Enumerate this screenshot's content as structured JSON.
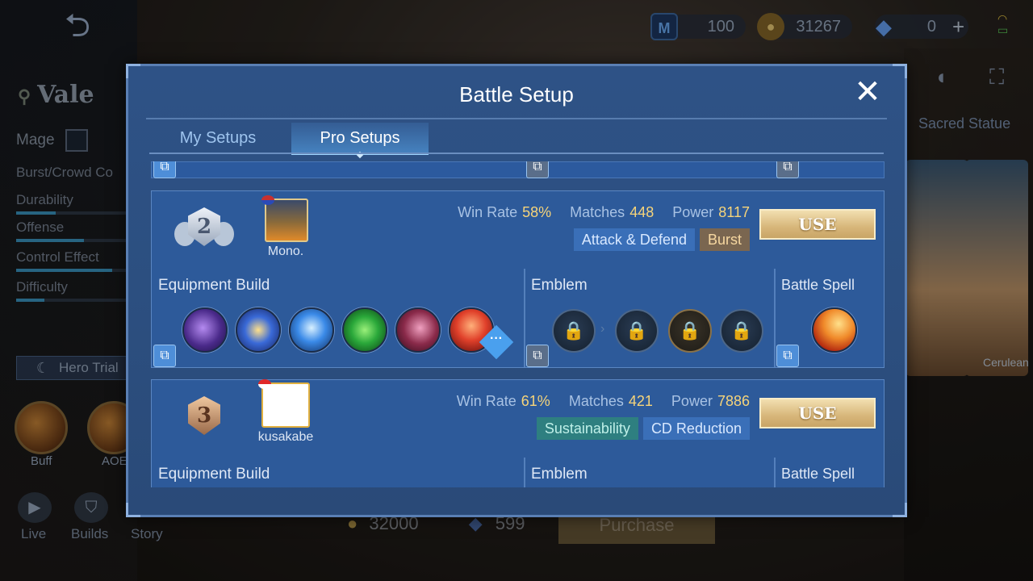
{
  "topbar": {
    "currencies": [
      {
        "icon": "m-token-icon",
        "value": "100"
      },
      {
        "icon": "gold-coin-icon",
        "value": "31267"
      },
      {
        "icon": "diamond-icon",
        "value": "0"
      }
    ]
  },
  "hero": {
    "name": "Vale",
    "role": "Mage",
    "type": "Burst/Crowd Co",
    "stats": [
      {
        "label": "Durability",
        "level": 0.35
      },
      {
        "label": "Offense",
        "level": 0.6
      },
      {
        "label": "Control Effect",
        "level": 0.85
      },
      {
        "label": "Difficulty",
        "level": 0.25
      }
    ],
    "trial_label": "Hero Trial",
    "skills": [
      {
        "label": "Buff"
      },
      {
        "label": "AOE"
      }
    ]
  },
  "bottom_nav": [
    {
      "label": "Live",
      "icon": "live-icon"
    },
    {
      "label": "Builds",
      "icon": "builds-icon"
    },
    {
      "label": "Story",
      "icon": "story-icon"
    }
  ],
  "shop": {
    "gold_price": "32000",
    "diamond_price": "599",
    "purchase_label": "Purchase"
  },
  "right_panel": {
    "sacred_label": "Sacred Statue",
    "skin_labels": [
      "Cerulean"
    ]
  },
  "modal": {
    "title": "Battle Setup",
    "tabs": [
      {
        "label": "My Setups",
        "active": false
      },
      {
        "label": "Pro Setups",
        "active": true
      }
    ],
    "setups": [
      {
        "rank": "2",
        "player_name": "Mono.",
        "win_rate_label": "Win Rate",
        "win_rate": "58%",
        "matches_label": "Matches",
        "matches": "448",
        "power_label": "Power",
        "power": "8117",
        "tags": [
          {
            "text": "Attack & Defend",
            "style": "blue"
          },
          {
            "text": "Burst",
            "style": "brown"
          }
        ],
        "use_label": "USE",
        "equipment_title": "Equipment Build",
        "emblem_title": "Emblem",
        "spell_title": "Battle Spell",
        "items": [
          "arcane-boots-icon",
          "clock-of-destiny-icon",
          "lightning-truncheon-icon",
          "enchanted-talisman-icon",
          "blood-wings-icon",
          "fleeting-time-icon"
        ],
        "emblems": [
          "locked-emblem-icon",
          "locked-talent-icon",
          "locked-talent-icon",
          "locked-talent-icon"
        ],
        "spell": "flicker-spell-icon"
      },
      {
        "rank": "3",
        "player_name": "kusakabe",
        "win_rate_label": "Win Rate",
        "win_rate": "61%",
        "matches_label": "Matches",
        "matches": "421",
        "power_label": "Power",
        "power": "7886",
        "tags": [
          {
            "text": "Sustainability",
            "style": "teal"
          },
          {
            "text": "CD Reduction",
            "style": "blue"
          }
        ],
        "use_label": "USE",
        "equipment_title": "Equipment Build",
        "emblem_title": "Emblem",
        "spell_title": "Battle Spell"
      }
    ]
  },
  "colors": {
    "modal_bg": "#2e5286",
    "card_bg": "#2d5a9a",
    "stat_value": "#f6d47a",
    "use_button": "#d7b67a"
  }
}
